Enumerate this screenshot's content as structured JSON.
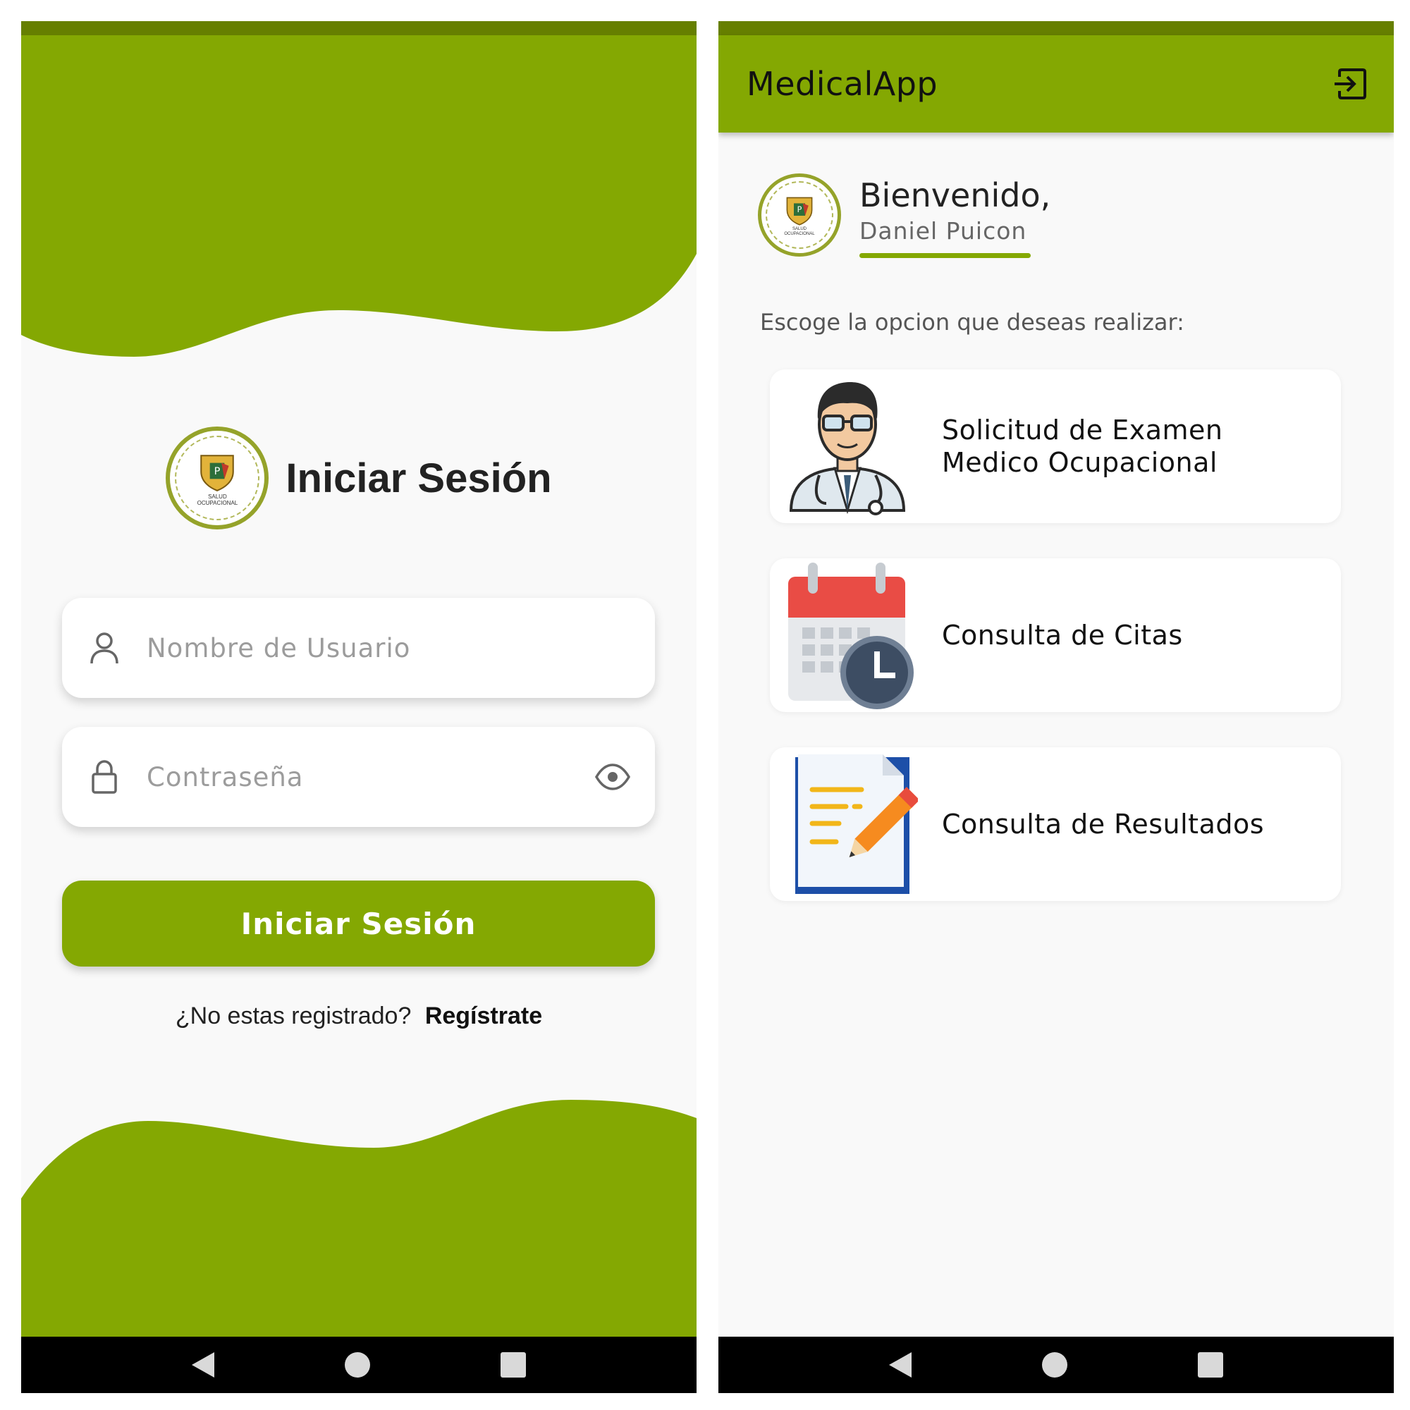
{
  "login": {
    "title": "Iniciar Sesión",
    "logo_text": [
      "SALUD",
      "OCUPACIONAL"
    ],
    "username": {
      "placeholder": "Nombre de Usuario",
      "icon": "user-icon"
    },
    "password": {
      "placeholder": "Contraseña",
      "icon": "lock-icon",
      "toggle_icon": "eye-icon"
    },
    "submit_label": "Iniciar Sesión",
    "register_prompt": "¿No estas registrado?",
    "register_link": "Regístrate"
  },
  "home": {
    "app_title": "MedicalApp",
    "logout_icon": "logout-icon",
    "greeting": "Bienvenido,",
    "user_name": "Daniel Puicon",
    "prompt": "Escoge la opcion que deseas realizar:",
    "options": [
      {
        "label": "Solicitud de Examen Medico Ocupacional",
        "icon": "doctor-icon"
      },
      {
        "label": "Consulta de Citas",
        "icon": "calendar-clock-icon"
      },
      {
        "label": "Consulta de Resultados",
        "icon": "document-pencil-icon"
      }
    ]
  },
  "colors": {
    "primary": "#84a802",
    "status_bar": "#667f00",
    "background": "#f9f9f9"
  }
}
